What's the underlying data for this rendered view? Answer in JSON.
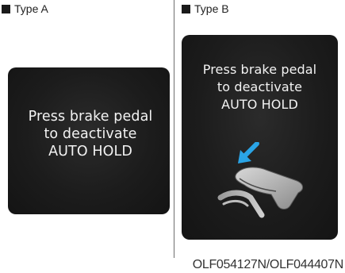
{
  "type_a": {
    "label": "Type A",
    "message": [
      "Press brake pedal",
      "to deactivate",
      "AUTO HOLD"
    ]
  },
  "type_b": {
    "label": "Type B",
    "message": [
      "Press brake pedal",
      "to deactivate",
      "AUTO HOLD"
    ],
    "icon": "foot-on-brake-pedal-icon"
  },
  "caption": "OLF054127N/OLF044407N",
  "colors": {
    "panel_background": "#1c1c1c",
    "panel_text": "#f2f2f2",
    "arrow_blue": "#2aa4e6",
    "divider": "#6e6e6e"
  }
}
